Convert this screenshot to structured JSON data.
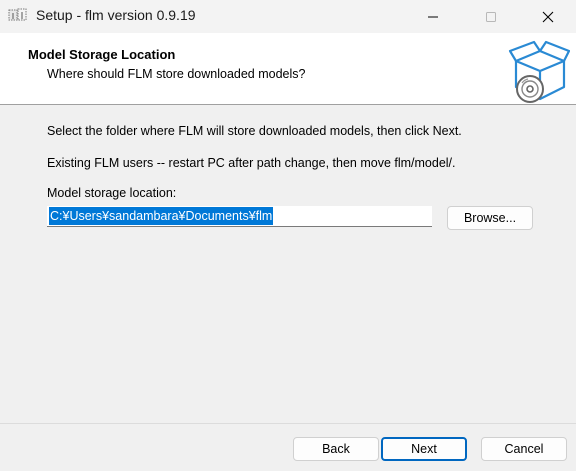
{
  "window": {
    "title": "Setup - flm version 0.9.19"
  },
  "header": {
    "title": "Model Storage Location",
    "subtitle": "Where should FLM store downloaded models?"
  },
  "body": {
    "instruction": "Select the folder where FLM will store downloaded models, then click Next.",
    "note": "Existing FLM users -- restart PC after path change, then move flm/model/.",
    "field_label": "Model storage location:",
    "path_value": "C:¥Users¥sandambara¥Documents¥flm",
    "browse_label": "Browse..."
  },
  "footer": {
    "back_label": "Back",
    "next_label": "Next",
    "cancel_label": "Cancel"
  },
  "colors": {
    "selection": "#0078d7",
    "accent_border": "#0067c0"
  }
}
